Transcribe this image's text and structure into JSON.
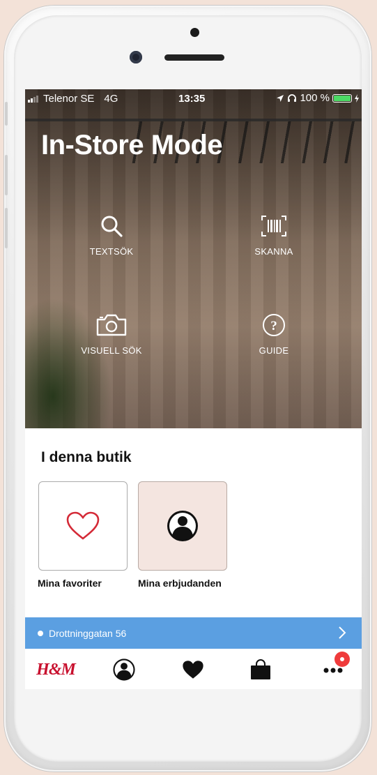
{
  "status": {
    "carrier": "Telenor SE",
    "network": "4G",
    "time": "13:35",
    "battery": "100 %"
  },
  "hero": {
    "title": "In-Store Mode",
    "actions": [
      {
        "label": "TEXTSÖK",
        "icon": "search-icon"
      },
      {
        "label": "SKANNA",
        "icon": "barcode-icon"
      },
      {
        "label": "VISUELL SÖK",
        "icon": "camera-icon"
      },
      {
        "label": "GUIDE",
        "icon": "question-icon"
      }
    ]
  },
  "store_section": {
    "title": "I denna butik",
    "tiles": [
      {
        "label": "Mina favoriter",
        "icon": "heart-outline-icon"
      },
      {
        "label": "Mina erbjudanden",
        "icon": "user-circle-icon"
      }
    ]
  },
  "store_bar": {
    "name": "Drottninggatan 56"
  },
  "tabbar": {
    "logo": "H&M",
    "items": [
      "logo",
      "profile-icon",
      "heart-icon",
      "bag-icon",
      "more-icon"
    ]
  },
  "colors": {
    "brand_red": "#c8102e",
    "store_bar_blue": "#5b9fe1",
    "badge_red": "#ef3b3b",
    "offers_tile_bg": "#f4e5e0",
    "battery_green": "#4cd964"
  }
}
